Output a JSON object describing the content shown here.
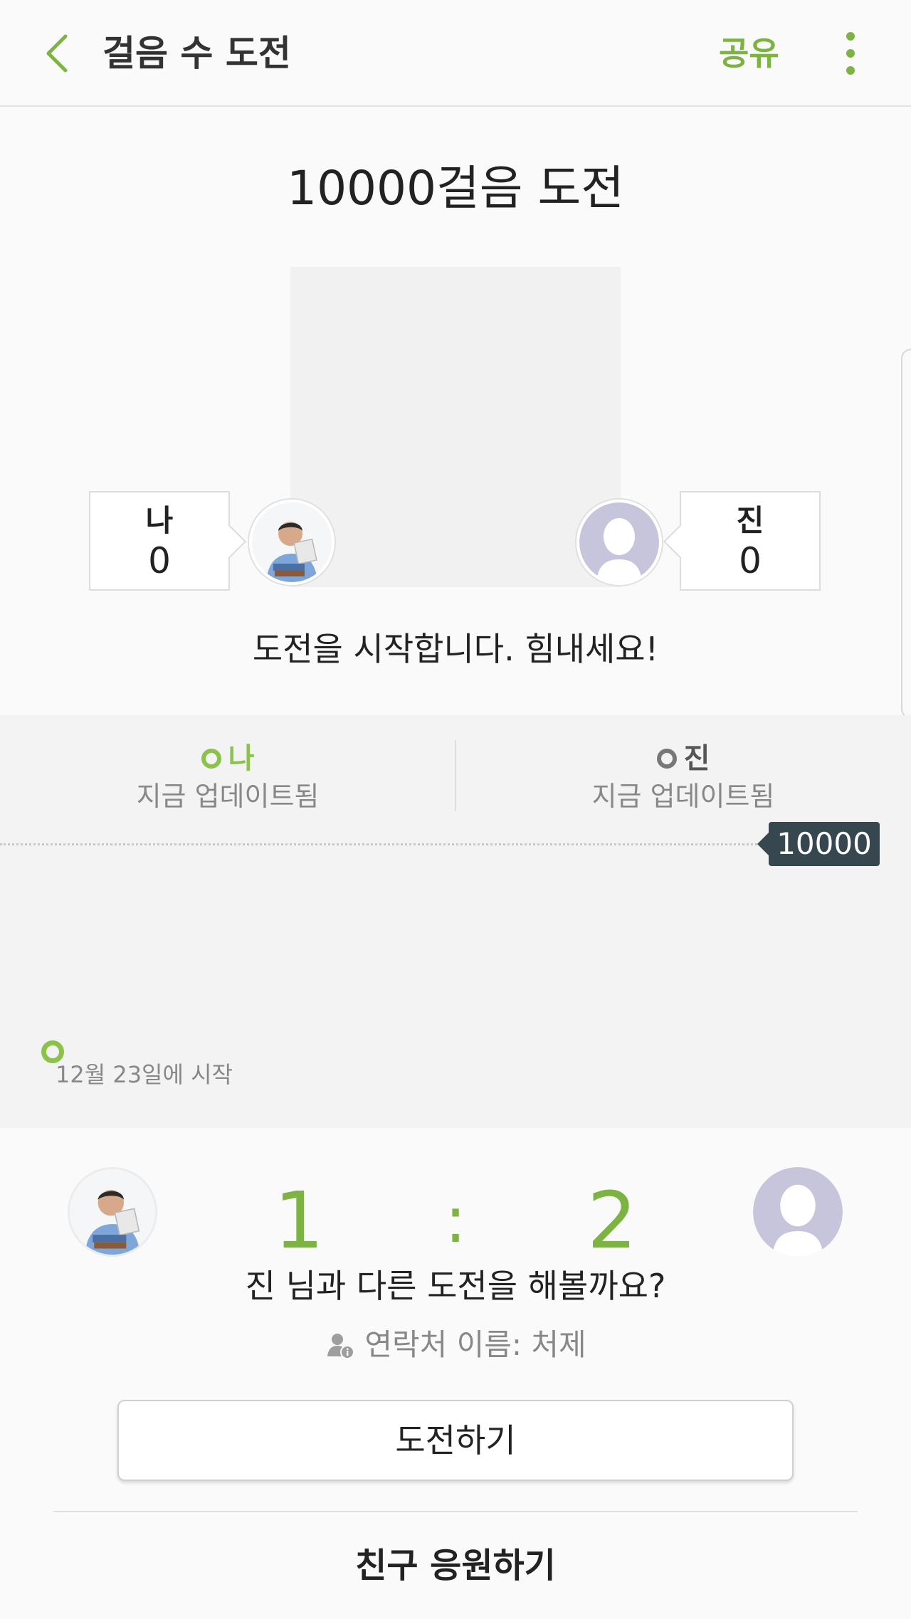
{
  "appbar": {
    "title": "걸음 수 도전",
    "share_label": "공유",
    "back_icon": "chevron-left-icon",
    "more_icon": "more-vert-icon",
    "accent_color": "#7cb342"
  },
  "challenge": {
    "title": "10000걸음 도전",
    "me": {
      "name": "나",
      "steps": "0"
    },
    "friend": {
      "name": "진",
      "steps": "0"
    },
    "message": "도전을 시작합니다. 힘내세요!"
  },
  "progress": {
    "me": {
      "name": "나",
      "status": "지금 업데이트됨",
      "color": "#8bc34a"
    },
    "friend": {
      "name": "진",
      "status": "지금 업데이트됨",
      "color": "#777777"
    },
    "goal": "10000",
    "start_label": "12월 23일에 시작"
  },
  "result": {
    "score_me": "1",
    "separator": ":",
    "score_friend": "2",
    "question": "진 님과 다른 도전을 해볼까요?",
    "contact_label": "연락처 이름: 처제",
    "challenge_button": "도전하기",
    "cheer_button": "친구 응원하기"
  }
}
